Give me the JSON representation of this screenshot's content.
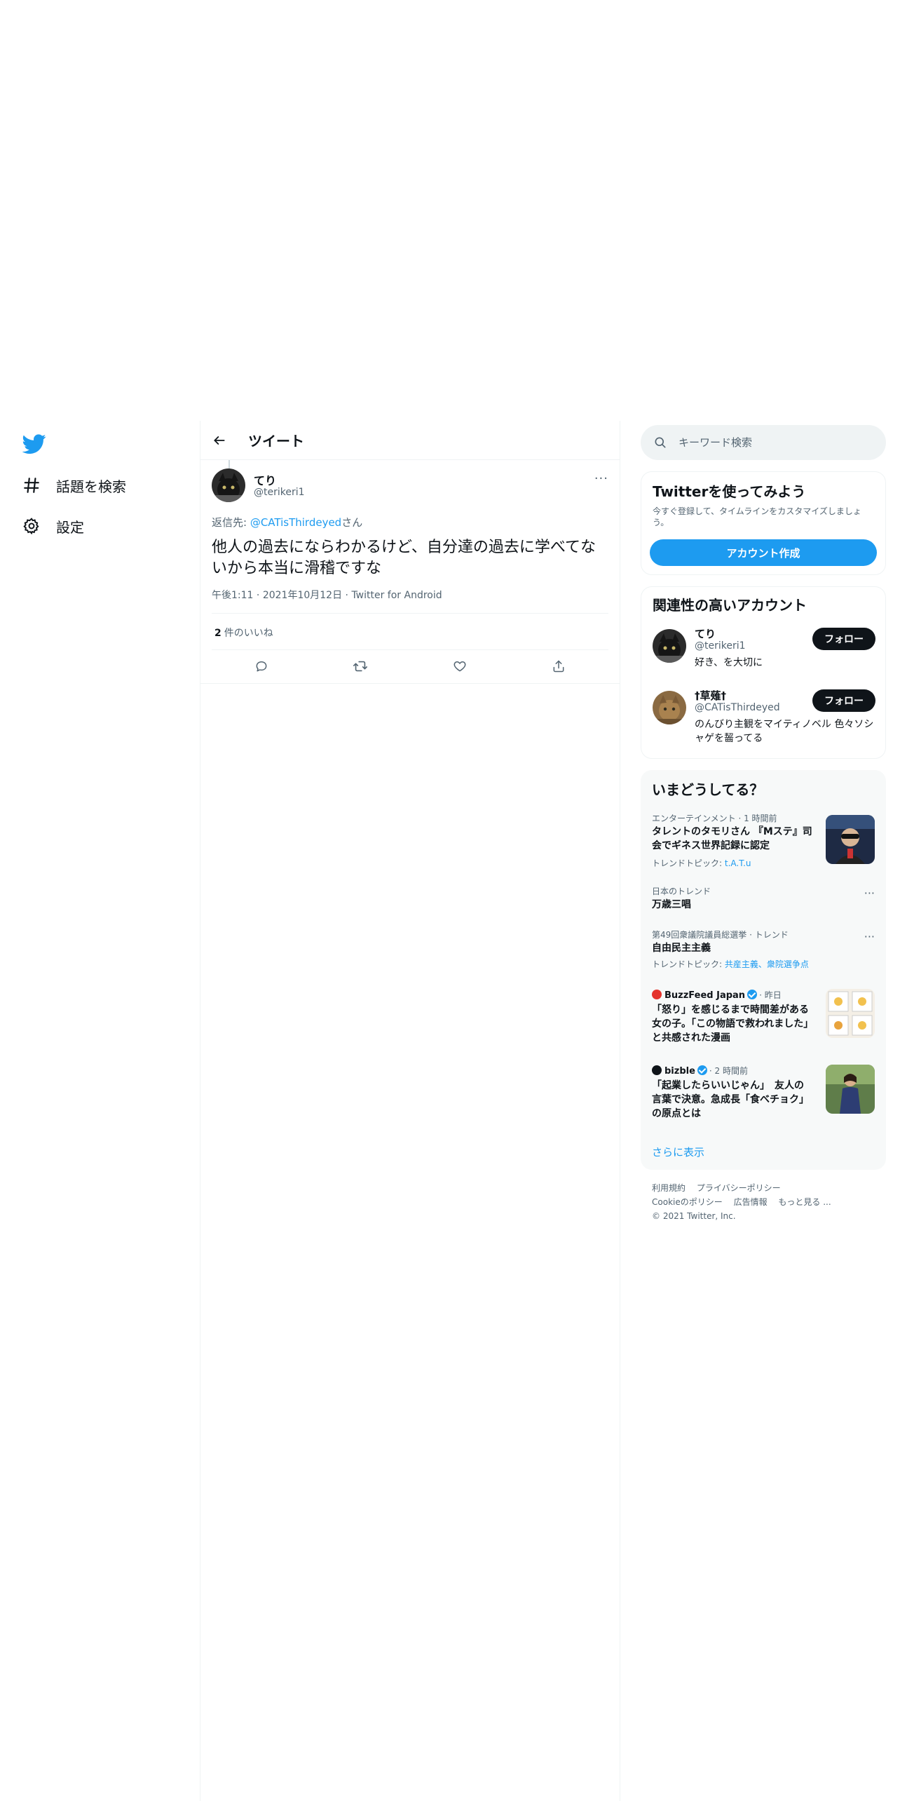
{
  "nav": {
    "items": [
      {
        "label": "話題を検索",
        "icon": "hashtag-icon"
      },
      {
        "label": "設定",
        "icon": "gear-icon"
      }
    ]
  },
  "tweet_page": {
    "header_title": "ツイート",
    "author": {
      "name": "てり",
      "handle": "@terikeri1"
    },
    "reply_to_label": "返信先: ",
    "reply_to_handle": "@CATisThirdeyed",
    "reply_to_suffix": "さん",
    "text": "他人の過去にならわかるけど、自分達の過去に学べてないから本当に滑稽ですな",
    "time": "午後1:11",
    "date": "2021年10月12日",
    "source": "Twitter for Android",
    "dot_separator": "·",
    "likes_count": "2",
    "likes_label": "件のいいね"
  },
  "search": {
    "placeholder": "キーワード検索"
  },
  "signup_card": {
    "title": "Twitterを使ってみよう",
    "description": "今すぐ登録して、タイムラインをカスタマイズしましょう。",
    "button": "アカウント作成"
  },
  "related": {
    "title": "関連性の高いアカウント",
    "accounts": [
      {
        "name": "てり",
        "handle": "@terikeri1",
        "bio": "好き、を大切に",
        "follow": "フォロー"
      },
      {
        "name": "†草薙†",
        "handle": "@CATisThirdeyed",
        "bio": "のんびり主観をマイティノベル 色々ソシャゲを齧ってる",
        "follow": "フォロー"
      }
    ]
  },
  "trends": {
    "title": "いまどうしてる？",
    "items": [
      {
        "category": "エンターテインメント · 1 時間前",
        "title": "タレントのタモリさん 『Mステ』司会でギネス世界記録に認定",
        "sub_label": "トレンドトピック: ",
        "sub_link": "t.A.T.u"
      },
      {
        "category": "日本のトレンド",
        "title": "万歳三唱"
      },
      {
        "category": "第49回衆議院議員総選挙 · トレンド",
        "title": "自由民主主義",
        "sub_label": "トレンドトピック: ",
        "sub_link": "共産主義、衆院選争点"
      },
      {
        "source": "BuzzFeed Japan",
        "time": "· 昨日",
        "title": "「怒り」を感じるまで時間差がある女の子。「この物語で救われました」と共感された漫画"
      },
      {
        "source": "bizble",
        "time": "· 2 時間前",
        "title": "「起業したらいいじゃん」　友人の言葉で決意。急成長「食べチョク」の原点とは"
      }
    ],
    "show_more": "さらに表示"
  },
  "footer": {
    "links": [
      "利用規約",
      "プライバシーポリシー",
      "Cookieのポリシー",
      "広告情報",
      "もっと見る ..."
    ],
    "copyright": "© 2021 Twitter, Inc."
  },
  "colors": {
    "accent": "#1d9bf0",
    "text": "#0f1419",
    "muted": "#536471",
    "border": "#eff3f4"
  }
}
